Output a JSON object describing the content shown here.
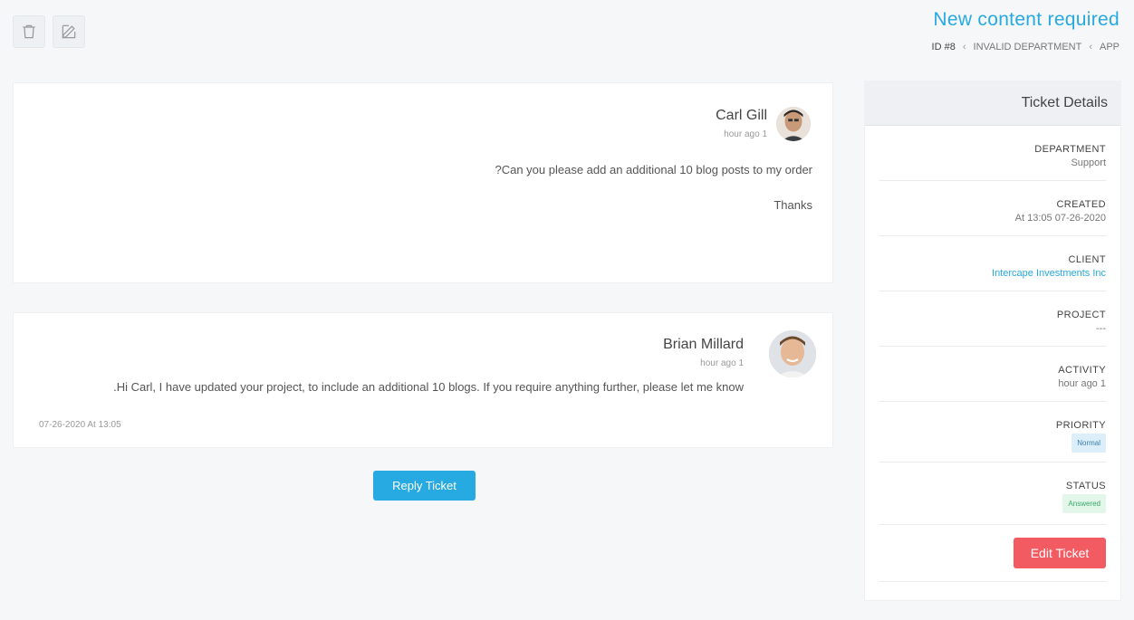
{
  "header": {
    "title": "New content required",
    "breadcrumb": [
      "APP",
      "INVALID DEPARTMENT",
      "ID #8"
    ]
  },
  "actions": {
    "edit_icon": "edit-icon",
    "delete_icon": "trash-icon"
  },
  "details": {
    "heading": "Ticket Details",
    "items": [
      {
        "label": "DEPARTMENT",
        "value": "Support"
      },
      {
        "label": "CREATED",
        "value": "07-26-2020 At 13:05"
      },
      {
        "label": "CLIENT",
        "value": "Intercape Investments Inc"
      },
      {
        "label": "PROJECT",
        "value": "---"
      },
      {
        "label": "ACTIVITY",
        "value": "1 hour ago"
      },
      {
        "label": "PRIORITY",
        "value": "Normal"
      },
      {
        "label": "STATUS",
        "value": "Answered"
      }
    ],
    "edit_label": "Edit Ticket"
  },
  "messages": [
    {
      "author": "Carl Gill",
      "time": "1 hour ago",
      "lines": [
        "Can you please add an additional 10 blog posts to my order?",
        "Thanks"
      ]
    },
    {
      "author": "Brian Millard",
      "time": "1 hour ago",
      "body": "Hi Carl, I have updated your project, to include an additional 10 blogs. If you require anything further, please let me know.",
      "timestamp": "07-26-2020 At 13:05"
    }
  ],
  "reply_label": "Reply Ticket",
  "colors": {
    "accent": "#27a9e1",
    "danger": "#f25b62",
    "background": "#f5f7f9"
  }
}
